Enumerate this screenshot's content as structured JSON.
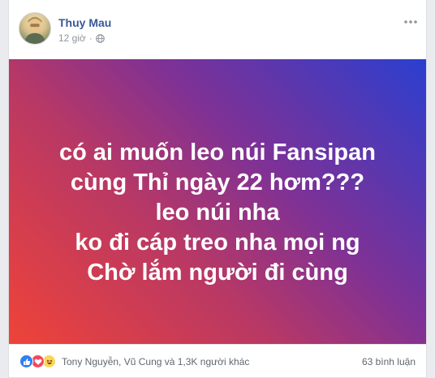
{
  "post": {
    "author": "Thuy Mau",
    "time": "12 giờ",
    "separator": "·",
    "privacy_icon": "globe-icon",
    "more_icon": "ellipsis-icon",
    "text_lines": [
      "có ai muốn leo núi Fansipan",
      "cùng Thỉ ngày 22 hơm???",
      "leo núi nha",
      "ko đi cáp treo nha mọi ng",
      "Chờ lắm người đi cùng"
    ],
    "background": {
      "gradient_colors": [
        "#ef4338",
        "#b83865",
        "#7e3196",
        "#2b3fcf"
      ]
    }
  },
  "footer": {
    "reaction_icons": [
      "like-icon",
      "love-icon",
      "haha-icon"
    ],
    "reactors_text": "Tony Nguyễn, Vũ Cung và 1,3K người khác",
    "comments_text": "63 bình luận"
  },
  "colors": {
    "author": "#385898",
    "meta": "#90949c",
    "footer_text": "#606770",
    "like": "#2e7ef6",
    "love": "#f2495e",
    "haha": "#fcd55a"
  }
}
